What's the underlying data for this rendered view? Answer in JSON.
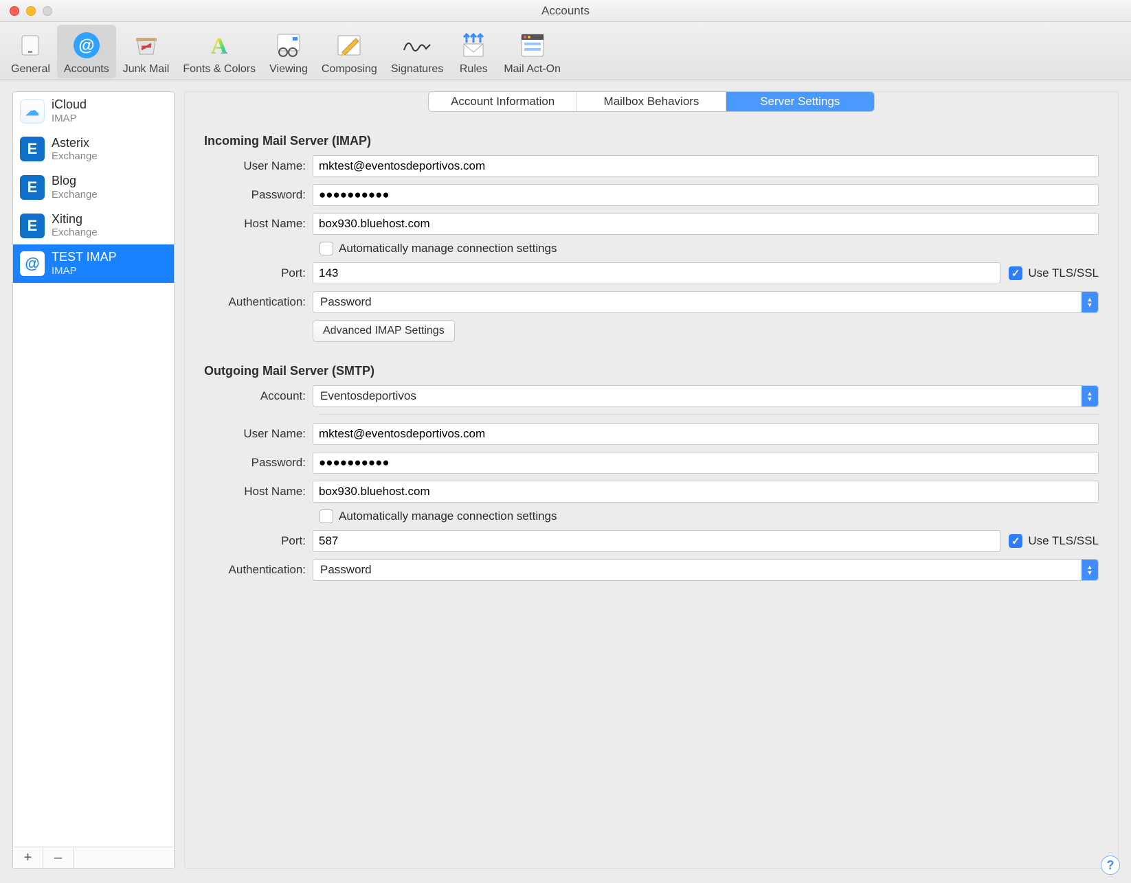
{
  "window": {
    "title": "Accounts"
  },
  "toolbar": {
    "items": [
      {
        "label": "General"
      },
      {
        "label": "Accounts"
      },
      {
        "label": "Junk Mail"
      },
      {
        "label": "Fonts & Colors"
      },
      {
        "label": "Viewing"
      },
      {
        "label": "Composing"
      },
      {
        "label": "Signatures"
      },
      {
        "label": "Rules"
      },
      {
        "label": "Mail Act-On"
      }
    ]
  },
  "sidebar": {
    "accounts": [
      {
        "name": "iCloud",
        "type": "IMAP"
      },
      {
        "name": "Asterix",
        "type": "Exchange"
      },
      {
        "name": "Blog",
        "type": "Exchange"
      },
      {
        "name": "Xiting",
        "type": "Exchange"
      },
      {
        "name": "TEST IMAP",
        "type": "IMAP"
      }
    ],
    "add_label": "+",
    "remove_label": "–"
  },
  "tabs": [
    {
      "label": "Account Information"
    },
    {
      "label": "Mailbox Behaviors"
    },
    {
      "label": "Server Settings"
    }
  ],
  "labels": {
    "incoming_section": "Incoming Mail Server (IMAP)",
    "outgoing_section": "Outgoing Mail Server (SMTP)",
    "user_name": "User Name:",
    "password": "Password:",
    "host_name": "Host Name:",
    "auto_manage": "Automatically manage connection settings",
    "port": "Port:",
    "use_tls": "Use TLS/SSL",
    "authentication": "Authentication:",
    "advanced_imap": "Advanced IMAP Settings",
    "account": "Account:",
    "help": "?"
  },
  "incoming": {
    "user_name": "mktest@eventosdeportivos.com",
    "password": "●●●●●●●●●●",
    "host_name": "box930.bluehost.com",
    "auto_manage_checked": false,
    "port": "143",
    "tls_checked": true,
    "authentication": "Password"
  },
  "outgoing": {
    "account": "Eventosdeportivos",
    "user_name": "mktest@eventosdeportivos.com",
    "password": "●●●●●●●●●●",
    "host_name": "box930.bluehost.com",
    "auto_manage_checked": false,
    "port": "587",
    "tls_checked": true,
    "authentication": "Password"
  }
}
